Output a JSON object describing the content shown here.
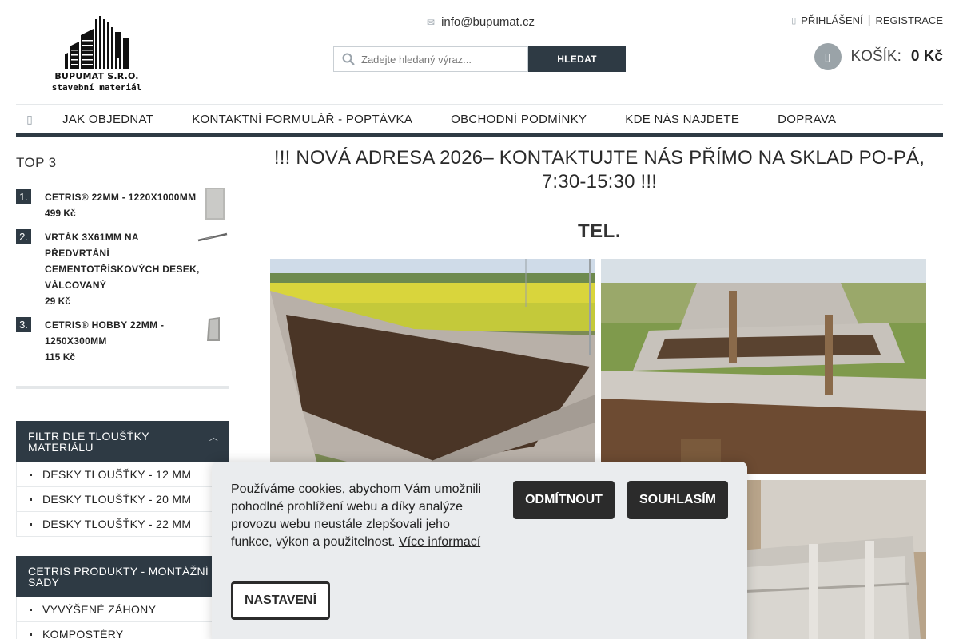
{
  "header": {
    "logo": {
      "line1": "BUPUMAT S.R.O.",
      "line2": "stavební materiál"
    },
    "email": "info@bupumat.cz",
    "search": {
      "placeholder": "Zadejte hledaný výraz...",
      "button": "HLEDAT"
    },
    "account": {
      "login": "PŘIHLÁŠENÍ",
      "separator": "|",
      "register": "REGISTRACE"
    },
    "cart": {
      "label": "KOŠÍK:",
      "amount": "0 Kč"
    }
  },
  "nav": {
    "items": [
      "JAK OBJEDNAT",
      "KONTAKTNÍ FORMULÁŘ - POPTÁVKA",
      "OBCHODNÍ PODMÍNKY",
      "KDE NÁS NAJDETE",
      "DOPRAVA"
    ]
  },
  "sidebar": {
    "top_title": "TOP 3",
    "top": [
      {
        "num": "1.",
        "name": "CETRIS® 22MM - 1220X1000MM",
        "price": "499 Kč"
      },
      {
        "num": "2.",
        "name": "VRTÁK 3X61MM NA PŘEDVRTÁNÍ CEMENTOTŘÍSKOVÝCH DESEK, VÁLCOVANÝ",
        "price": "29 Kč"
      },
      {
        "num": "3.",
        "name": "CETRIS® HOBBY 22MM - 1250X300MM",
        "price": "115 Kč"
      }
    ],
    "filter1": {
      "title": "FILTR DLE TLOUŠŤKY MATERIÁLU",
      "items": [
        "DESKY TLOUŠŤKY - 12 MM",
        "DESKY TLOUŠŤKY - 20 MM",
        "DESKY TLOUŠŤKY - 22 MM"
      ]
    },
    "filter2": {
      "title": "CETRIS PRODUKTY - MONTÁŽNÍ SADY",
      "items": [
        "VYVÝŠENÉ ZÁHONY",
        "KOMPOSTÉRY"
      ]
    }
  },
  "main": {
    "headline": "!!!  NOVÁ ADRESA 2026– KONTAKTUJTE NÁS PŘÍMO NA SKLAD PO-PÁ, 7:30-15:30 !!!",
    "tel": "TEL."
  },
  "cookie": {
    "text": "Používáme cookies, abychom Vám umožnili pohodlné prohlížení webu a díky analýze provozu webu neustále zlepšovali jeho funkce, výkon a použitelnost.",
    "link": "Více informací",
    "decline": "ODMÍTNOUT",
    "accept": "SOUHLASÍM",
    "settings": "NASTAVENÍ"
  },
  "colors": {
    "accent": "#2e3a44",
    "cookie_bg": "#eaecee",
    "button_dark": "#2b2b2b"
  }
}
